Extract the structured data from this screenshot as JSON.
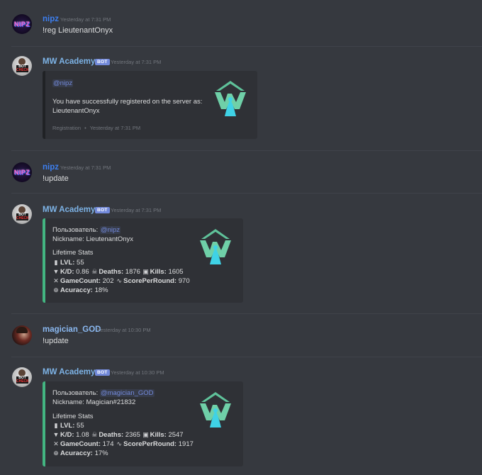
{
  "messages": [
    {
      "author": "nipz",
      "timestamp": "Yesterday at 7:31 PM",
      "text": "!reg LieutenantOnyx"
    },
    {
      "author": "MW Academy",
      "bot_tag": "BOT",
      "timestamp": "Yesterday at 7:31 PM",
      "embed": {
        "mention": "@nipz",
        "line1": "You have successfully registered on the server as:",
        "line2": "LieutenantOnyx",
        "footer": "Registration",
        "footer_sep": "•",
        "footer_time": "Yesterday at 7:31 PM"
      }
    },
    {
      "author": "nipz",
      "timestamp": "Yesterday at 7:31 PM",
      "text": "!update"
    },
    {
      "author": "MW Academy",
      "bot_tag": "BOT",
      "timestamp": "Yesterday at 7:31 PM",
      "embed": {
        "user_label": "Пользователь:",
        "user_mention": "@nipz",
        "nickname": "Nickname: LieutenantOnyx",
        "section": "Lifetime Stats",
        "lvl_label": "LVL:",
        "lvl": "55",
        "kd_label": "K/D:",
        "kd": "0.86",
        "deaths_label": "Deaths:",
        "deaths": "1876",
        "kills_label": "Kills:",
        "kills": "1605",
        "gamecount_label": "GameCount:",
        "gamecount": "202",
        "spr_label": "ScorePerRound:",
        "spr": "970",
        "accuracy_label": "Acuraccy:",
        "accuracy": "18%"
      }
    },
    {
      "author": "magician_GOD",
      "timestamp": "Yesterday at 10:30 PM",
      "text": "!update"
    },
    {
      "author": "MW Academy",
      "bot_tag": "BOT",
      "timestamp": "Yesterday at 10:30 PM",
      "embed": {
        "user_label": "Пользователь:",
        "user_mention": "@magician_GOD",
        "nickname": "Nickname: Magician#21832",
        "section": "Lifetime Stats",
        "lvl_label": "LVL:",
        "lvl": "55",
        "kd_label": "K/D:",
        "kd": "1.08",
        "deaths_label": "Deaths:",
        "deaths": "2365",
        "kills_label": "Kills:",
        "kills": "2547",
        "gamecount_label": "GameCount:",
        "gamecount": "174",
        "spr_label": "ScorePerRound:",
        "spr": "1917",
        "accuracy_label": "Acuraccy:",
        "accuracy": "17%"
      }
    }
  ],
  "avatars": {
    "nipz": "NIPZ",
    "bot": "BOT",
    "bot_sub": "CHECK"
  },
  "icons": {
    "lvl": "level-icon",
    "kd": "gun-icon",
    "deaths": "skull-icon",
    "kills": "kills-icon",
    "gamecount": "crossed-swords-icon",
    "spr": "trend-icon",
    "accuracy": "crosshair-icon"
  },
  "colors": {
    "background": "#36393f",
    "embed_bg": "#2f3136",
    "embed_accent": "#43b581",
    "mention": "#7289da",
    "bot_tag": "#7289da",
    "logo_green": "#5fc29a",
    "logo_cyan": "#3fd2e6"
  }
}
